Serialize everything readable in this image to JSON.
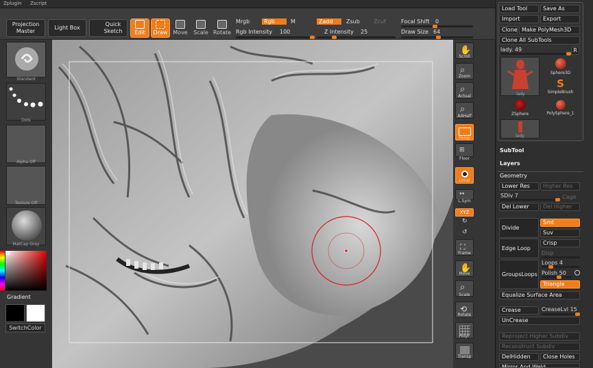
{
  "menubar": {
    "items": [
      "Zplugin",
      "Zscript"
    ]
  },
  "topbar": {
    "projection_master": "Projection\nMaster",
    "light_box": "Light Box",
    "quick_sketch": "Quick\nSketch",
    "edit": "Edit",
    "draw": "Draw",
    "move": "Move",
    "scale": "Scale",
    "rotate": "Rotate",
    "mrgb": "Mrgb",
    "rgb": "Rgb",
    "m": "M",
    "rgb_intensity_label": "Rgb Intensity",
    "rgb_intensity_value": "100",
    "zadd": "Zadd",
    "zsub": "Zsub",
    "zcut": "Zcut",
    "z_intensity_label": "Z Intensity",
    "z_intensity_value": "25",
    "focal_shift_label": "Focal Shift",
    "focal_shift_value": "0",
    "draw_size_label": "Draw Size",
    "draw_size_value": "64",
    "rgb_intensity_level": 1.0,
    "z_intensity_level": 0.25,
    "focal_shift_level": 0.5,
    "draw_size_level": 0.55
  },
  "leftshelf": {
    "standard": "Standard",
    "dots": "Dots",
    "alpha": "Alpha Off",
    "texture": "Texture Off",
    "matcap": "MatCap Gray",
    "gradient": "Gradient",
    "switch_color": "SwitchColor"
  },
  "rightshelf": {
    "scroll": "Scroll",
    "zoom": "Zoom",
    "actual": "Actual",
    "aahalf": "AAHalf",
    "persp": "Persp",
    "floor": "Floor",
    "local": "Local",
    "lsym": "L.Sym",
    "xyz": "XYZ",
    "frame": "Frame",
    "move": "Move",
    "scale": "Scale",
    "rotate": "Rotate",
    "polyf": "PolyF",
    "transp": "Transp"
  },
  "tool": {
    "load_tool": "Load Tool",
    "save_as": "Save As",
    "import": "Import",
    "export": "Export",
    "clone": "Clone",
    "make_polymesh": "Make PolyMesh3D",
    "clone_all": "Clone All SubTools",
    "current_tool": "lady. 49",
    "r": "R",
    "thumbs": [
      "lady",
      "Sphere3D",
      "SimpleBrush",
      "ZSphere",
      "PolySphere_1",
      "lady"
    ]
  },
  "subtool": "SubTool",
  "layers": "Layers",
  "geometry": "Geometry",
  "geom": {
    "lower_res": "Lower Res",
    "higher_res": "Higher Res",
    "sdiv_label": "SDiv",
    "sdiv_value": "7",
    "cage": "Cage",
    "del_lower": "Del Lower",
    "del_higher": "Del Higher",
    "divide": "Divide",
    "smt": "Smt",
    "suv": "Suv",
    "edge_loop": "Edge Loop",
    "crisp": "Crisp",
    "disp": "Disp",
    "groups_loops": "GroupsLoops",
    "loops_label": "Loops",
    "loops_value": "4",
    "polish_label": "Polish",
    "polish_value": "50",
    "triangle": "Triangle",
    "equalize": "Equalize Surface Area",
    "crease": "Crease",
    "crease_lvl_label": "CreaseLvl",
    "crease_lvl_value": "15",
    "uncrease": "UnCrease",
    "reproject": "Reproject Higher Subdiv",
    "reconstruct": "Reconstruct Subdiv",
    "del_hidden": "DelHidden",
    "close_holes": "Close Holes",
    "mirror_weld": "Mirror And Weld"
  },
  "colors": {
    "accent": "#f07d1c",
    "panel": "#2f2f2f",
    "brush_ring": "#d42020"
  }
}
